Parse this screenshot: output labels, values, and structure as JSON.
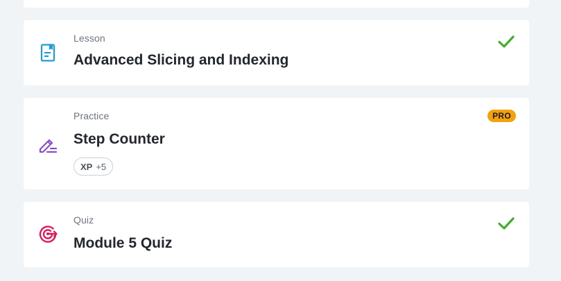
{
  "items": [
    {
      "type_label": "Lesson",
      "title": "Advanced Slicing and Indexing",
      "icon": "lesson-book-icon",
      "icon_color": "#1e9ae0",
      "completed": true
    },
    {
      "type_label": "Practice",
      "title": "Step Counter",
      "icon": "practice-pencil-icon",
      "icon_color": "#8a4ccf",
      "badge": "PRO",
      "xp_label": "XP",
      "xp_value": "+5",
      "completed": false
    },
    {
      "type_label": "Quiz",
      "title": "Module 5 Quiz",
      "icon": "quiz-target-icon",
      "icon_color": "#e0185b",
      "completed": true
    }
  ],
  "colors": {
    "background": "#f1f4f7",
    "card": "#ffffff",
    "check": "#3fae2a",
    "pro_badge": "#f5a10c",
    "title_text": "#22272e",
    "label_text": "#6c7580"
  }
}
